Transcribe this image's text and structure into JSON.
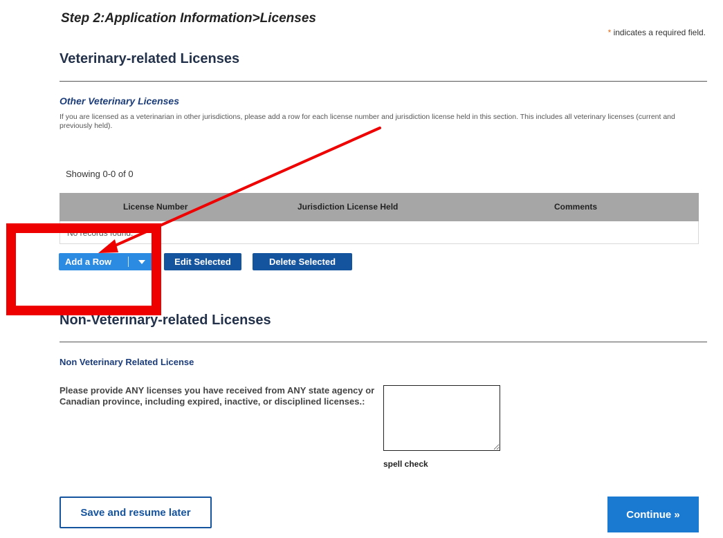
{
  "step_title": "Step 2:Application Information>Licenses",
  "required_note": {
    "star": "*",
    "text": "indicates a required field."
  },
  "vet_section": {
    "heading": "Veterinary-related Licenses",
    "sub_heading": "Other Veterinary Licenses",
    "description": "If you are licensed as a veterinarian in other jurisdictions, please add a row for each license number and jurisdiction license held in this section. This includes all veterinary licenses (current and previously held).",
    "showing": "Showing 0-0 of 0",
    "columns": [
      "License Number",
      "Jurisdiction License Held",
      "Comments"
    ],
    "empty_message": "No records found.",
    "add_row_label": "Add a Row",
    "edit_selected_label": "Edit Selected",
    "delete_selected_label": "Delete Selected"
  },
  "non_vet_section": {
    "heading": "Non-Veterinary-related Licenses",
    "field_label": "Non Veterinary Related License",
    "prompt": "Please provide ANY licenses you have received from ANY state agency or Canadian province, including expired, inactive, or disciplined licenses.:",
    "textarea_value": "",
    "spell_check": "spell check"
  },
  "footer": {
    "save_label": "Save and resume later",
    "continue_label": "Continue »"
  },
  "icons": {
    "dropdown": "chevron-down-icon"
  },
  "colors": {
    "primary_dark": "#14539e",
    "primary_light": "#2b8ae1",
    "continue": "#1a7ad2",
    "annotation": "#ee0000",
    "required_star": "#e06a1a"
  }
}
